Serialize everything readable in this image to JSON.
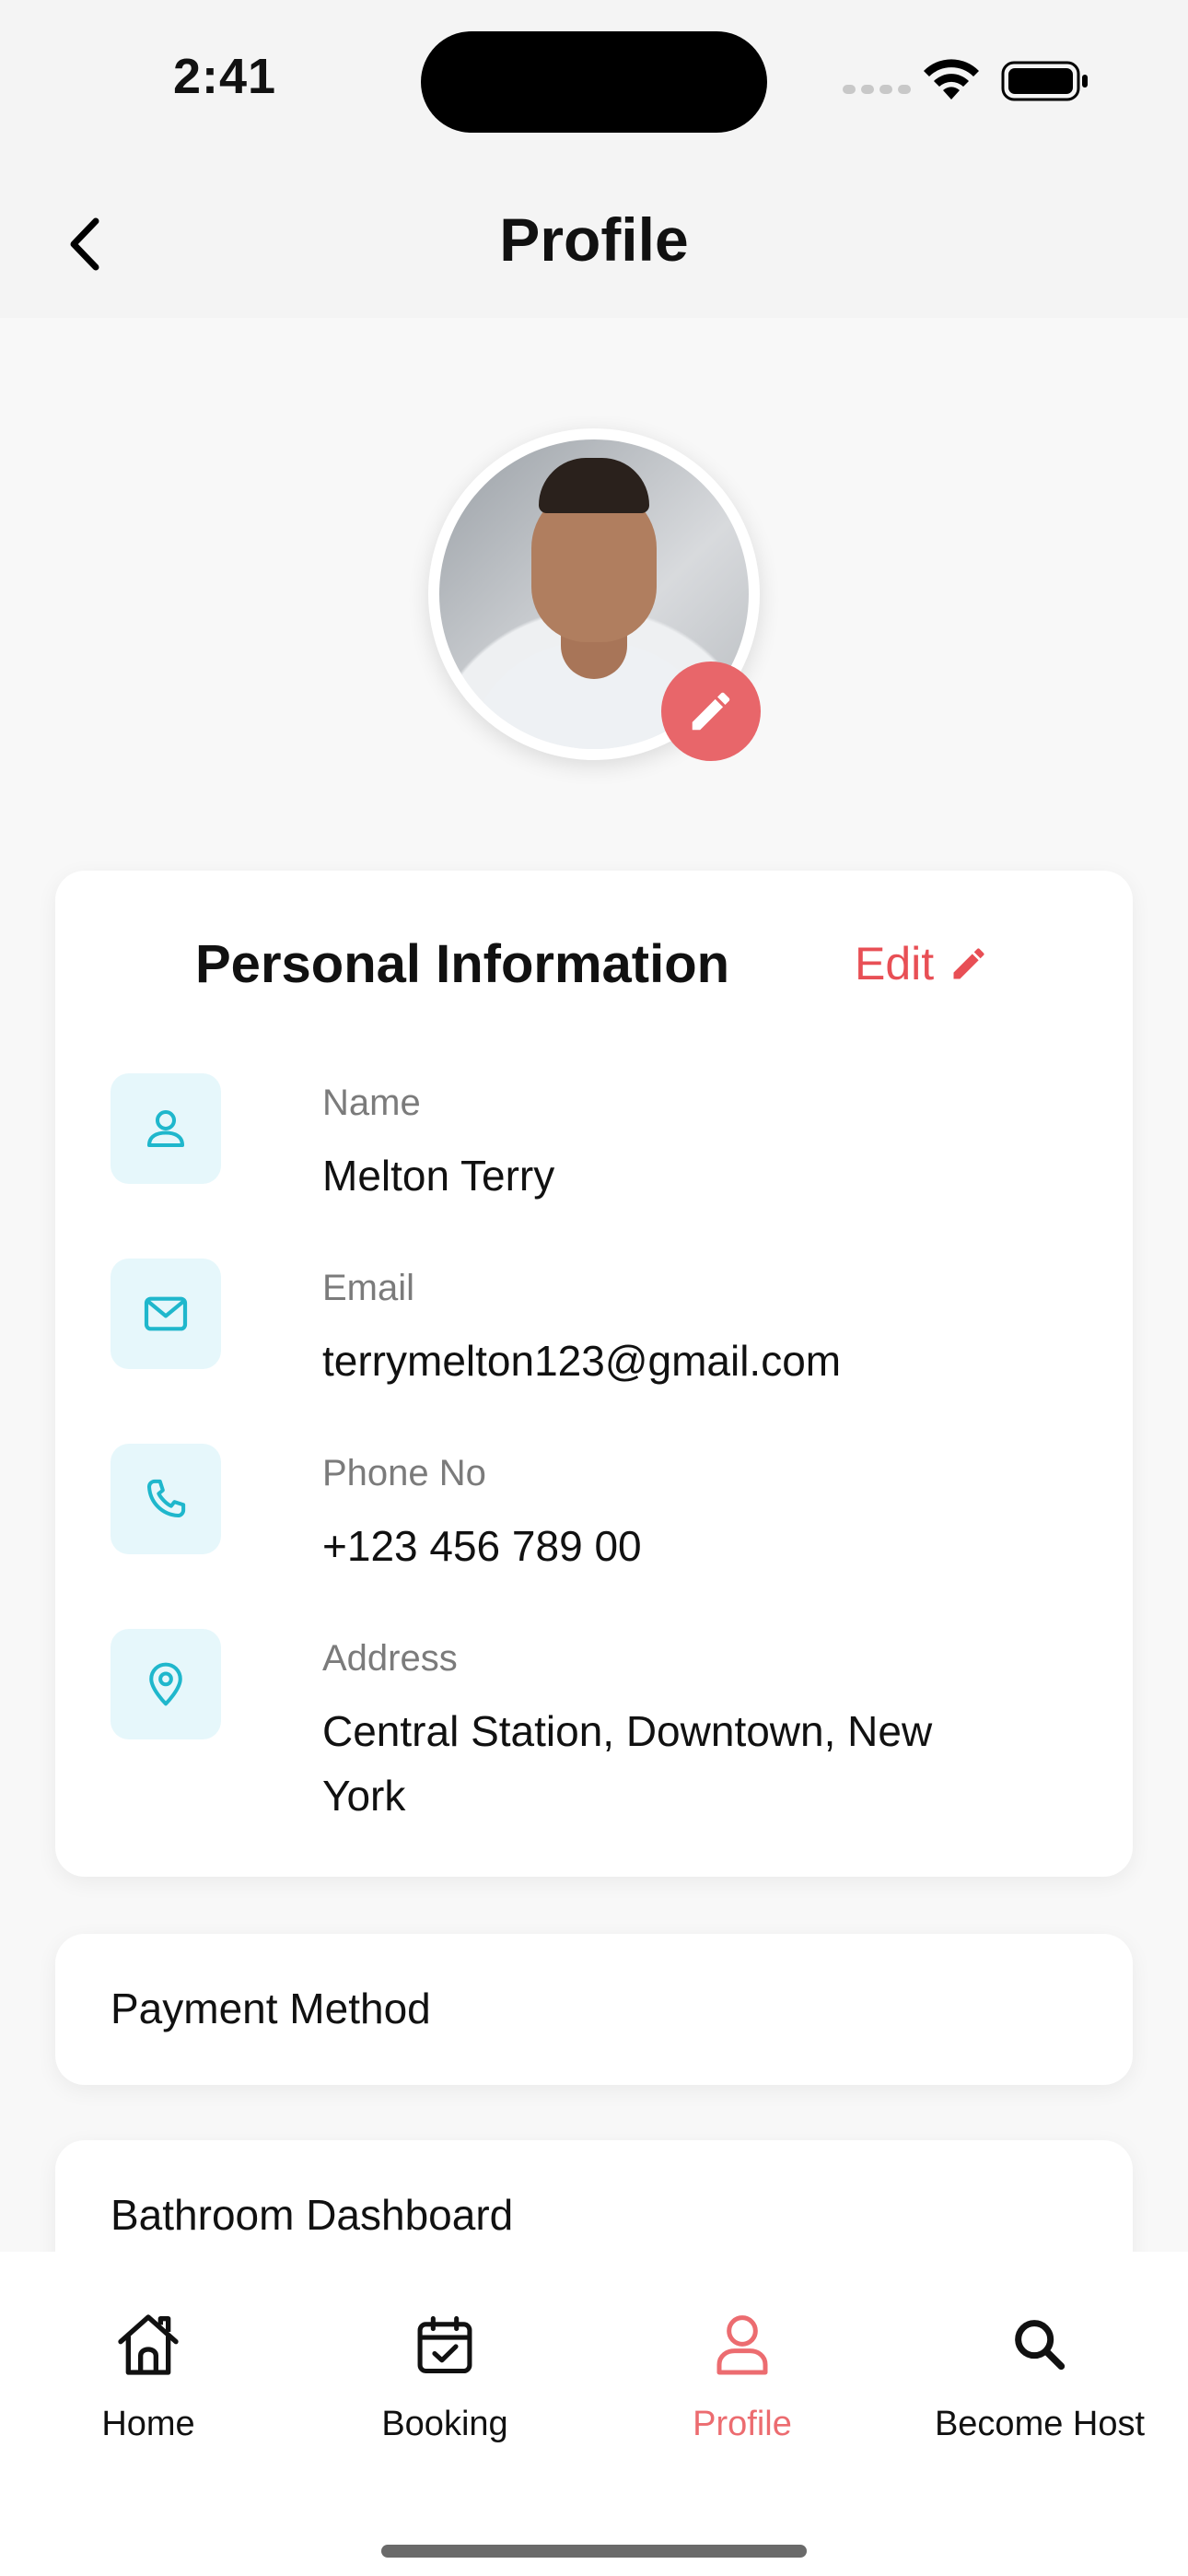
{
  "status_bar": {
    "time": "2:41"
  },
  "header": {
    "title": "Profile"
  },
  "personal_info": {
    "title": "Personal Information",
    "edit_label": "Edit",
    "fields": [
      {
        "icon": "person-icon",
        "label": "Name",
        "value": "Melton Terry"
      },
      {
        "icon": "mail-icon",
        "label": "Email",
        "value": "terrymelton123@gmail.com"
      },
      {
        "icon": "phone-icon",
        "label": "Phone No",
        "value": "+123 456 789 00"
      },
      {
        "icon": "location-pin-icon",
        "label": "Address",
        "value": "Central Station, Downtown, New York"
      }
    ]
  },
  "menu": [
    {
      "label": "Payment Method"
    },
    {
      "label": "Bathroom Dashboard"
    }
  ],
  "tabs": [
    {
      "label": "Home",
      "icon": "home-icon",
      "active": false
    },
    {
      "label": "Booking",
      "icon": "calendar-check-icon",
      "active": false
    },
    {
      "label": "Profile",
      "icon": "person-icon",
      "active": true
    },
    {
      "label": "Become Host",
      "icon": "search-icon",
      "active": false
    }
  ],
  "colors": {
    "accent": "#E8666A",
    "info_icon": "#1FB7CC",
    "icon_bg": "#E6F7FB"
  }
}
